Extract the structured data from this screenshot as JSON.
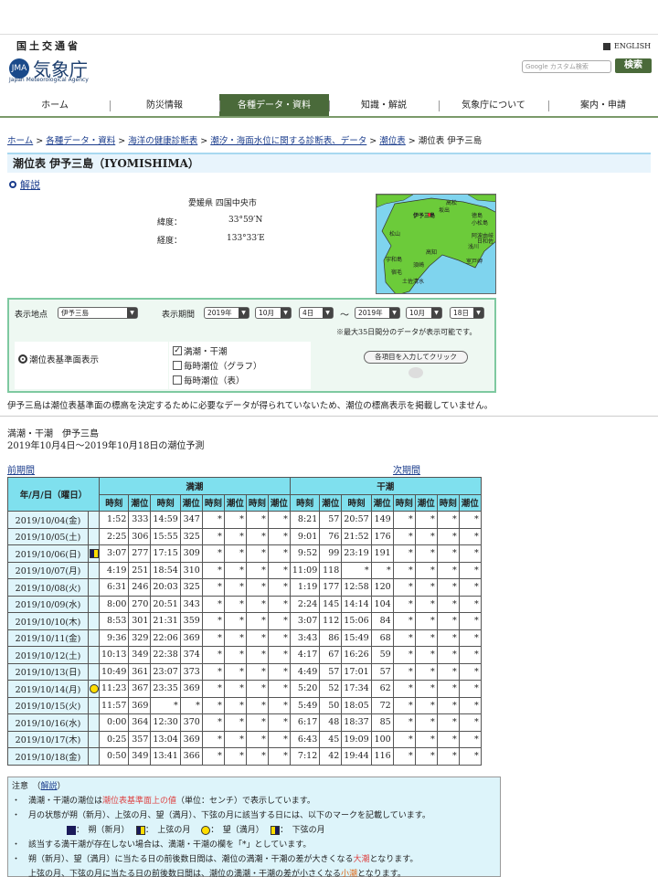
{
  "header": {
    "org": "国土交通省",
    "agency": "気象庁",
    "agency_en": "Japan Meteorological Agency",
    "english_link": "ENGLISH",
    "search_placeholder": "Google カスタム検索",
    "search_button": "検索"
  },
  "nav": [
    "ホーム",
    "防災情報",
    "各種データ・資料",
    "知識・解説",
    "気象庁について",
    "案内・申請"
  ],
  "breadcrumb": {
    "links": [
      "ホーム",
      "各種データ・資料",
      "海洋の健康診断表",
      "潮汐・海面水位に関する診断表、データ",
      "潮位表"
    ],
    "current": "潮位表 伊予三島"
  },
  "page_title": "潮位表 伊予三島（IYOMISHIMA）",
  "kaisetsu": "解説",
  "station": {
    "location": "愛媛県 四国中央市",
    "lat_label": "緯度：",
    "lat": "33°59′N",
    "lon_label": "経度：",
    "lon": "133°33′E"
  },
  "map": {
    "sea_color": "#7fd4ee",
    "land_color": "#6ccb3a",
    "labels": [
      "伊予三島",
      "松山",
      "高知",
      "宇和島",
      "室戸岬",
      "土佐清水",
      "小松島",
      "徳島",
      "阿波由岐",
      "浅川",
      "須崎",
      "宿毛",
      "高松",
      "坂出",
      "日和佐"
    ]
  },
  "form": {
    "location_label": "表示地点",
    "location_value": "伊予三島",
    "period_label": "表示期間",
    "from": {
      "year": "2019年",
      "month": "10月",
      "day": "4日"
    },
    "tilde": "〜",
    "to": {
      "year": "2019年",
      "month": "10月",
      "day": "18日"
    },
    "max_note": "※最大35日間分のデータが表示可能です。",
    "radio_label": "潮位表基準面表示",
    "checks": [
      {
        "label": "満潮・干潮",
        "checked": true
      },
      {
        "label": "毎時潮位（グラフ）",
        "checked": false
      },
      {
        "label": "毎時潮位（表）",
        "checked": false
      }
    ],
    "submit": "各項目を入力してクリック"
  },
  "note_line": "伊予三島は潮位表基準面の標高を決定するために必要なデータが得られていないため、潮位の標高表示を掲載していません。",
  "section": {
    "title": "満潮・干潮　伊予三島",
    "subtitle": "2019年10月4日〜2019年10月18日の潮位予測"
  },
  "prev_link": "前期間",
  "next_link": "次期間",
  "table": {
    "date_header": "年/月/日（曜日）",
    "high_header": "満潮",
    "low_header": "干潮",
    "time_label": "時刻",
    "level_label": "潮位",
    "rows": [
      {
        "date": "2019/10/04(金)",
        "moon": "",
        "high": [
          "1:52",
          "333",
          "14:59",
          "347",
          "*",
          "*",
          "*",
          "*"
        ],
        "low": [
          "8:21",
          "57",
          "20:57",
          "149",
          "*",
          "*",
          "*",
          "*"
        ]
      },
      {
        "date": "2019/10/05(土)",
        "moon": "",
        "high": [
          "2:25",
          "306",
          "15:55",
          "325",
          "*",
          "*",
          "*",
          "*"
        ],
        "low": [
          "9:01",
          "76",
          "21:52",
          "176",
          "*",
          "*",
          "*",
          "*"
        ]
      },
      {
        "date": "2019/10/06(日)",
        "moon": "first",
        "high": [
          "3:07",
          "277",
          "17:15",
          "309",
          "*",
          "*",
          "*",
          "*"
        ],
        "low": [
          "9:52",
          "99",
          "23:19",
          "191",
          "*",
          "*",
          "*",
          "*"
        ]
      },
      {
        "date": "2019/10/07(月)",
        "moon": "",
        "high": [
          "4:19",
          "251",
          "18:54",
          "310",
          "*",
          "*",
          "*",
          "*"
        ],
        "low": [
          "11:09",
          "118",
          "*",
          "*",
          "*",
          "*",
          "*",
          "*"
        ]
      },
      {
        "date": "2019/10/08(火)",
        "moon": "",
        "high": [
          "6:31",
          "246",
          "20:03",
          "325",
          "*",
          "*",
          "*",
          "*"
        ],
        "low": [
          "1:19",
          "177",
          "12:58",
          "120",
          "*",
          "*",
          "*",
          "*"
        ]
      },
      {
        "date": "2019/10/09(水)",
        "moon": "",
        "high": [
          "8:00",
          "270",
          "20:51",
          "343",
          "*",
          "*",
          "*",
          "*"
        ],
        "low": [
          "2:24",
          "145",
          "14:14",
          "104",
          "*",
          "*",
          "*",
          "*"
        ]
      },
      {
        "date": "2019/10/10(木)",
        "moon": "",
        "high": [
          "8:53",
          "301",
          "21:31",
          "359",
          "*",
          "*",
          "*",
          "*"
        ],
        "low": [
          "3:07",
          "112",
          "15:06",
          "84",
          "*",
          "*",
          "*",
          "*"
        ]
      },
      {
        "date": "2019/10/11(金)",
        "moon": "",
        "high": [
          "9:36",
          "329",
          "22:06",
          "369",
          "*",
          "*",
          "*",
          "*"
        ],
        "low": [
          "3:43",
          "86",
          "15:49",
          "68",
          "*",
          "*",
          "*",
          "*"
        ]
      },
      {
        "date": "2019/10/12(土)",
        "moon": "",
        "high": [
          "10:13",
          "349",
          "22:38",
          "374",
          "*",
          "*",
          "*",
          "*"
        ],
        "low": [
          "4:17",
          "67",
          "16:26",
          "59",
          "*",
          "*",
          "*",
          "*"
        ]
      },
      {
        "date": "2019/10/13(日)",
        "moon": "",
        "high": [
          "10:49",
          "361",
          "23:07",
          "373",
          "*",
          "*",
          "*",
          "*"
        ],
        "low": [
          "4:49",
          "57",
          "17:01",
          "57",
          "*",
          "*",
          "*",
          "*"
        ]
      },
      {
        "date": "2019/10/14(月)",
        "moon": "full",
        "high": [
          "11:23",
          "367",
          "23:35",
          "369",
          "*",
          "*",
          "*",
          "*"
        ],
        "low": [
          "5:20",
          "52",
          "17:34",
          "62",
          "*",
          "*",
          "*",
          "*"
        ]
      },
      {
        "date": "2019/10/15(火)",
        "moon": "",
        "high": [
          "11:57",
          "369",
          "*",
          "*",
          "*",
          "*",
          "*",
          "*"
        ],
        "low": [
          "5:49",
          "50",
          "18:05",
          "72",
          "*",
          "*",
          "*",
          "*"
        ]
      },
      {
        "date": "2019/10/16(水)",
        "moon": "",
        "high": [
          "0:00",
          "364",
          "12:30",
          "370",
          "*",
          "*",
          "*",
          "*"
        ],
        "low": [
          "6:17",
          "48",
          "18:37",
          "85",
          "*",
          "*",
          "*",
          "*"
        ]
      },
      {
        "date": "2019/10/17(木)",
        "moon": "",
        "high": [
          "0:25",
          "357",
          "13:04",
          "369",
          "*",
          "*",
          "*",
          "*"
        ],
        "low": [
          "6:43",
          "45",
          "19:09",
          "100",
          "*",
          "*",
          "*",
          "*"
        ]
      },
      {
        "date": "2019/10/18(金)",
        "moon": "",
        "high": [
          "0:50",
          "349",
          "13:41",
          "366",
          "*",
          "*",
          "*",
          "*"
        ],
        "low": [
          "7:12",
          "42",
          "19:44",
          "116",
          "*",
          "*",
          "*",
          "*"
        ]
      }
    ]
  },
  "notes": {
    "head": "注意",
    "head_link": "解説",
    "n1_pre": "満潮・干潮の潮位は",
    "n1_red": "潮位表基準面上の値",
    "n1_post": "（単位：センチ）で表示しています。",
    "n2": "月の状態が朔（新月）、上弦の月、望（満月）、下弦の月に該当する日には、以下のマークを記載しています。",
    "moon_new": "：　朔（新月）",
    "moon_first": "：　上弦の月",
    "moon_full": "：　望（満月）",
    "moon_last": "：　下弦の月",
    "n3": "該当する満干潮が存在しない場合は、満潮・干潮の欄を「*」としています。",
    "n4_pre": "朔（新月）、望（満月）に当たる日の前後数日間は、潮位の満潮・干潮の差が大きくなる",
    "n4_hl": "大潮",
    "n4_post": "となります。",
    "n5_pre": "上弦の月、下弦の月に当たる日の前後数日間は、潮位の満潮・干潮の差が小さくなる",
    "n5_hl": "小潮",
    "n5_post": "となります。"
  }
}
